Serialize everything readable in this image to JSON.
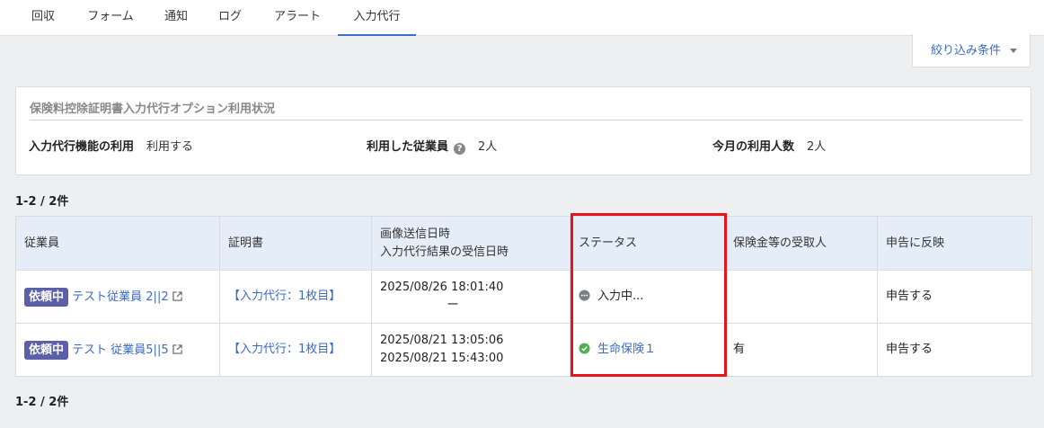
{
  "tabs": [
    {
      "label": "回収",
      "active": false
    },
    {
      "label": "フォーム",
      "active": false
    },
    {
      "label": "通知",
      "active": false
    },
    {
      "label": "ログ",
      "active": false
    },
    {
      "label": "アラート",
      "active": false
    },
    {
      "label": "入力代行",
      "active": true
    }
  ],
  "filter": {
    "label": "絞り込み条件"
  },
  "usage": {
    "title": "保険料控除証明書入力代行オプション利用状況",
    "feature_label": "入力代行機能の利用",
    "feature_value": "利用する",
    "employees_label": "利用した従業員",
    "employees_value": "2人",
    "monthly_label": "今月の利用人数",
    "monthly_value": "2人"
  },
  "pagination": {
    "top": "1-2 / 2件",
    "bottom": "1-2 / 2件"
  },
  "table": {
    "headers": {
      "employee": "従業員",
      "certificate": "証明書",
      "datetime_line1": "画像送信日時",
      "datetime_line2": "入力代行結果の受信日時",
      "status": "ステータス",
      "recipient": "保険金等の受取人",
      "reflect": "申告に反映"
    },
    "rows": [
      {
        "badge": "依頼中",
        "employee": "テスト従業員 2||2",
        "certificate": "【入力代行：1枚目】",
        "sent": "2025/08/26 18:01:40",
        "received": "ー",
        "status": "入力中...",
        "recipient": "",
        "reflect": "申告する"
      },
      {
        "badge": "依頼中",
        "employee": "テスト 従業員5||5",
        "certificate": "【入力代行：1枚目】",
        "sent": "2025/08/21 13:05:06",
        "received": "2025/08/21 15:43:00",
        "status": "生命保険１",
        "recipient": "有",
        "reflect": "申告する"
      }
    ]
  },
  "colors": {
    "accent": "#3a6bc6",
    "badge": "#5b5ea8",
    "highlight": "#e8141c",
    "status_done": "#4caf50"
  }
}
